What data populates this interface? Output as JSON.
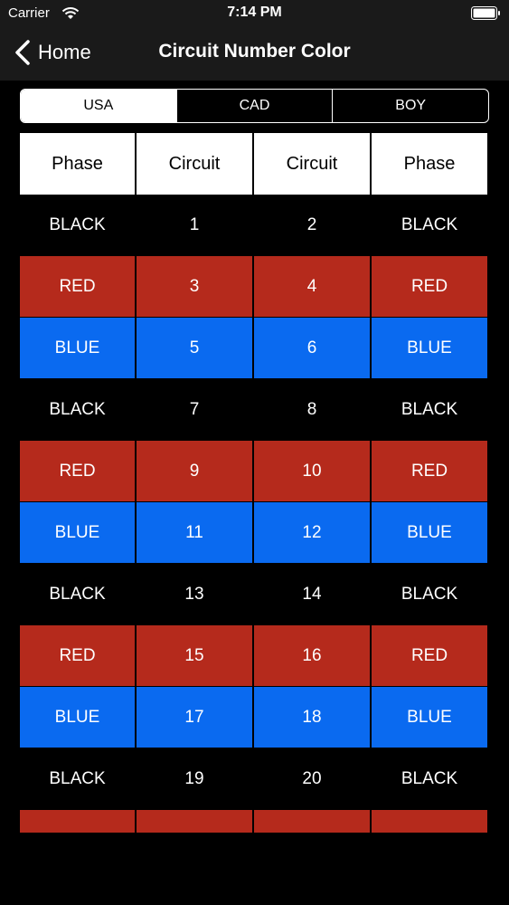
{
  "status_bar": {
    "carrier": "Carrier",
    "time": "7:14 PM"
  },
  "nav": {
    "back_label": "Home",
    "title": "Circuit Number Color"
  },
  "segments": [
    {
      "label": "USA",
      "selected": true
    },
    {
      "label": "CAD",
      "selected": false
    },
    {
      "label": "BOY",
      "selected": false
    }
  ],
  "table": {
    "headers": [
      "Phase",
      "Circuit",
      "Circuit",
      "Phase"
    ],
    "rows": [
      {
        "color": "black",
        "cells": [
          "BLACK",
          "1",
          "2",
          "BLACK"
        ]
      },
      {
        "color": "red",
        "cells": [
          "RED",
          "3",
          "4",
          "RED"
        ]
      },
      {
        "color": "blue",
        "cells": [
          "BLUE",
          "5",
          "6",
          "BLUE"
        ]
      },
      {
        "color": "black",
        "cells": [
          "BLACK",
          "7",
          "8",
          "BLACK"
        ]
      },
      {
        "color": "red",
        "cells": [
          "RED",
          "9",
          "10",
          "RED"
        ]
      },
      {
        "color": "blue",
        "cells": [
          "BLUE",
          "11",
          "12",
          "BLUE"
        ]
      },
      {
        "color": "black",
        "cells": [
          "BLACK",
          "13",
          "14",
          "BLACK"
        ]
      },
      {
        "color": "red",
        "cells": [
          "RED",
          "15",
          "16",
          "RED"
        ]
      },
      {
        "color": "blue",
        "cells": [
          "BLUE",
          "17",
          "18",
          "BLUE"
        ]
      },
      {
        "color": "black",
        "cells": [
          "BLACK",
          "19",
          "20",
          "BLACK"
        ]
      },
      {
        "color": "red",
        "cells": [
          "",
          "",
          "",
          ""
        ]
      }
    ]
  },
  "colors": {
    "red": "#b52a1c",
    "blue": "#0a6af0",
    "black": "#000000",
    "bar": "#1a1a1a"
  }
}
